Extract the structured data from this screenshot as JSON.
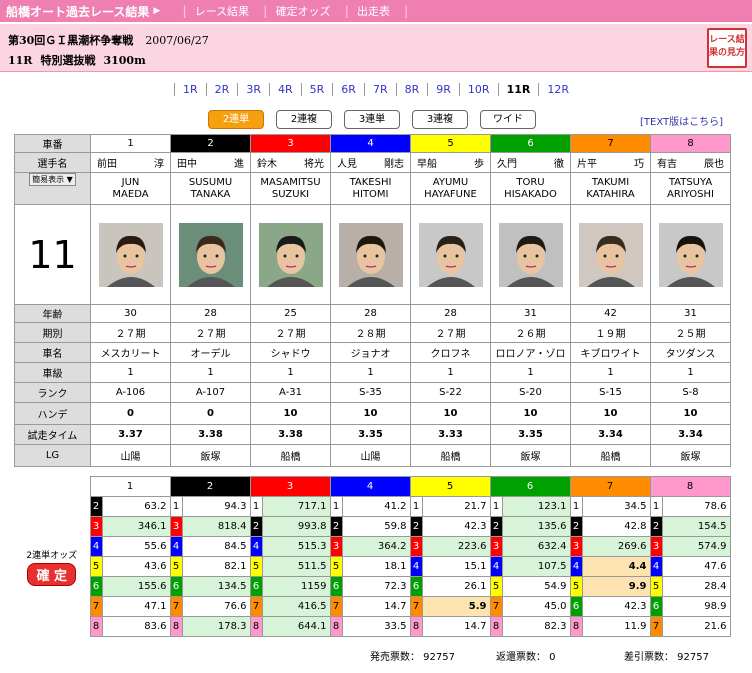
{
  "topbar": {
    "title": "船橋オート過去レース結果",
    "links": [
      "レース結果",
      "確定オッズ",
      "出走表"
    ]
  },
  "race": {
    "title": "第30回ＧＩ黒潮杯争奪戦",
    "date": "2007/06/27",
    "rno": "11R",
    "name": "特別選抜戦",
    "dist": "3100m",
    "help": "レース結果の見方"
  },
  "race_nav": [
    "1R",
    "2R",
    "3R",
    "4R",
    "5R",
    "6R",
    "7R",
    "8R",
    "9R",
    "10R",
    "11R",
    "12R"
  ],
  "current_race": "11R",
  "tabs": [
    "2連単",
    "2連複",
    "3連単",
    "3連複",
    "ワイド"
  ],
  "text_link": "[TEXT版はこちら]",
  "labels": {
    "num": "車番",
    "name": "選手名",
    "view": "簡易表示",
    "age": "年齢",
    "term": "期別",
    "car": "車名",
    "class": "車級",
    "rank": "ランク",
    "handi": "ハンデ",
    "time": "試走タイム",
    "lg": "LG",
    "odds": "2連単オッズ",
    "kakutei": "確 定",
    "big": "11"
  },
  "colors": [
    "#ffffff",
    "#000000",
    "#ff0000",
    "#0000ff",
    "#ffff00",
    "#00a000",
    "#ff8c00",
    "#ff99cc"
  ],
  "numcolors": [
    "#000000",
    "#ffffff",
    "#ffffff",
    "#ffffff",
    "#000000",
    "#ffffff",
    "#000000",
    "#000000"
  ],
  "riders": [
    {
      "num": "1",
      "fam": "前田",
      "giv": "淳",
      "rom1": "JUN",
      "rom2": "MAEDA",
      "age": "30",
      "term": "２７期",
      "car": "メスカリート",
      "class": "1",
      "rank": "A-106",
      "handi": "0",
      "time": "3.37",
      "lg": "山陽"
    },
    {
      "num": "2",
      "fam": "田中",
      "giv": "進",
      "rom1": "SUSUMU",
      "rom2": "TANAKA",
      "age": "28",
      "term": "２７期",
      "car": "オーデル",
      "class": "1",
      "rank": "A-107",
      "handi": "0",
      "time": "3.38",
      "lg": "飯塚"
    },
    {
      "num": "3",
      "fam": "鈴木",
      "giv": "将光",
      "rom1": "MASAMITSU",
      "rom2": "SUZUKI",
      "age": "25",
      "term": "２７期",
      "car": "シャドウ",
      "class": "1",
      "rank": "A-31",
      "handi": "10",
      "time": "3.38",
      "lg": "船橋"
    },
    {
      "num": "4",
      "fam": "人見",
      "giv": "剛志",
      "rom1": "TAKESHI",
      "rom2": "HITOMI",
      "age": "28",
      "term": "２８期",
      "car": "ジョナオ",
      "class": "1",
      "rank": "S-35",
      "handi": "10",
      "time": "3.35",
      "lg": "山陽"
    },
    {
      "num": "5",
      "fam": "早船",
      "giv": "歩",
      "rom1": "AYUMU",
      "rom2": "HAYAFUNE",
      "age": "28",
      "term": "２７期",
      "car": "クロフネ",
      "class": "1",
      "rank": "S-22",
      "handi": "10",
      "time": "3.33",
      "lg": "船橋"
    },
    {
      "num": "6",
      "fam": "久門",
      "giv": "徹",
      "rom1": "TORU",
      "rom2": "HISAKADO",
      "age": "31",
      "term": "２６期",
      "car": "ロロノア・ゾロ",
      "class": "1",
      "rank": "S-20",
      "handi": "10",
      "time": "3.35",
      "lg": "飯塚"
    },
    {
      "num": "7",
      "fam": "片平",
      "giv": "巧",
      "rom1": "TAKUMI",
      "rom2": "KATAHIRA",
      "age": "42",
      "term": "１９期",
      "car": "キブロワイト",
      "class": "1",
      "rank": "S-15",
      "handi": "10",
      "time": "3.34",
      "lg": "船橋"
    },
    {
      "num": "8",
      "fam": "有吉",
      "giv": "辰也",
      "rom1": "TATSUYA",
      "rom2": "ARIYOSHI",
      "age": "31",
      "term": "２５期",
      "car": "タツダンス",
      "class": "1",
      "rank": "S-8",
      "handi": "10",
      "time": "3.34",
      "lg": "飯塚"
    }
  ],
  "odds": [
    [
      "",
      "63.2",
      "346.1",
      "55.6",
      "43.6",
      "155.6",
      "47.1",
      "83.6"
    ],
    [
      "94.3",
      "",
      "818.4",
      "84.5",
      "82.1",
      "134.5",
      "76.6",
      "178.3"
    ],
    [
      "717.1",
      "993.8",
      "",
      "515.3",
      "511.5",
      "1159",
      "416.5",
      "644.1"
    ],
    [
      "41.2",
      "59.8",
      "364.2",
      "",
      "18.1",
      "72.3",
      "14.7",
      "33.5"
    ],
    [
      "21.7",
      "42.3",
      "223.6",
      "15.1",
      "",
      "26.1",
      "5.9",
      "14.7"
    ],
    [
      "123.1",
      "135.6",
      "632.4",
      "107.5",
      "54.9",
      "",
      "45.0",
      "82.3"
    ],
    [
      "34.5",
      "42.8",
      "269.6",
      "4.4",
      "9.9",
      "42.3",
      "",
      "11.9"
    ],
    [
      "78.6",
      "154.5",
      "574.9",
      "47.6",
      "28.4",
      "98.9",
      "21.6",
      ""
    ]
  ],
  "footer": {
    "sold": "発売票数： 92757",
    "ret": "返還票数： 0",
    "net": "差引票数： 92757"
  }
}
